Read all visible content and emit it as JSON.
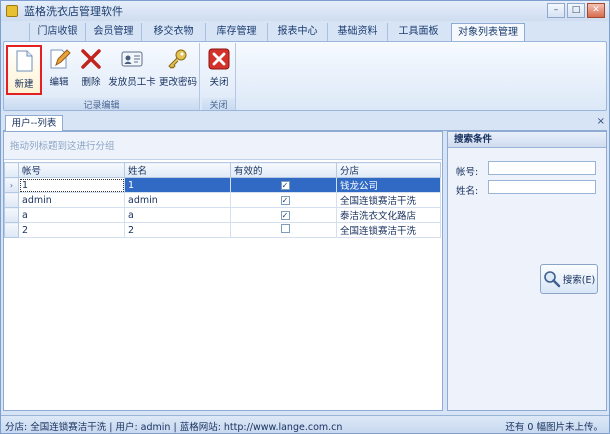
{
  "window": {
    "title": "蓝格洗衣店管理软件",
    "min": "–",
    "max": "□",
    "close": "✕"
  },
  "tabs": [
    "门店收银",
    "会员管理",
    "移交衣物",
    "库存管理",
    "报表中心",
    "基础资料",
    "工具面板",
    "对象列表管理"
  ],
  "ribbon": {
    "group1_caption": "记录编辑",
    "group2_caption": "关闭",
    "buttons": {
      "new": "新建",
      "edit": "编辑",
      "delete": "删除",
      "issue_card": "发放员工卡",
      "change_pwd": "更改密码",
      "close": "关闭"
    }
  },
  "doc_tab": {
    "label": "用户--列表",
    "close": "×"
  },
  "grid": {
    "group_hint": "拖动列标题到这进行分组",
    "columns": [
      "帐号",
      "姓名",
      "有效的",
      "分店"
    ],
    "rows": [
      {
        "indicator": "›",
        "account": "1",
        "name": "1",
        "valid": true,
        "store": "钱龙公司"
      },
      {
        "indicator": "",
        "account": "admin",
        "name": "admin",
        "valid": true,
        "store": "全国连锁赛洁干洗"
      },
      {
        "indicator": "",
        "account": "a",
        "name": "a",
        "valid": true,
        "store": "泰洁洗衣文化路店"
      },
      {
        "indicator": "",
        "account": "2",
        "name": "2",
        "valid": false,
        "store": "全国连锁赛洁干洗"
      }
    ]
  },
  "search": {
    "title": "搜索条件",
    "account_label": "帐号:",
    "account_value": "",
    "name_label": "姓名:",
    "name_value": "",
    "button": "搜索(E)"
  },
  "status": {
    "left": "分店: 全国连锁赛洁干洗  | 用户: admin  |  蓝格网站: http://www.lange.com.cn",
    "right": "还有 0 幅图片未上传。"
  }
}
